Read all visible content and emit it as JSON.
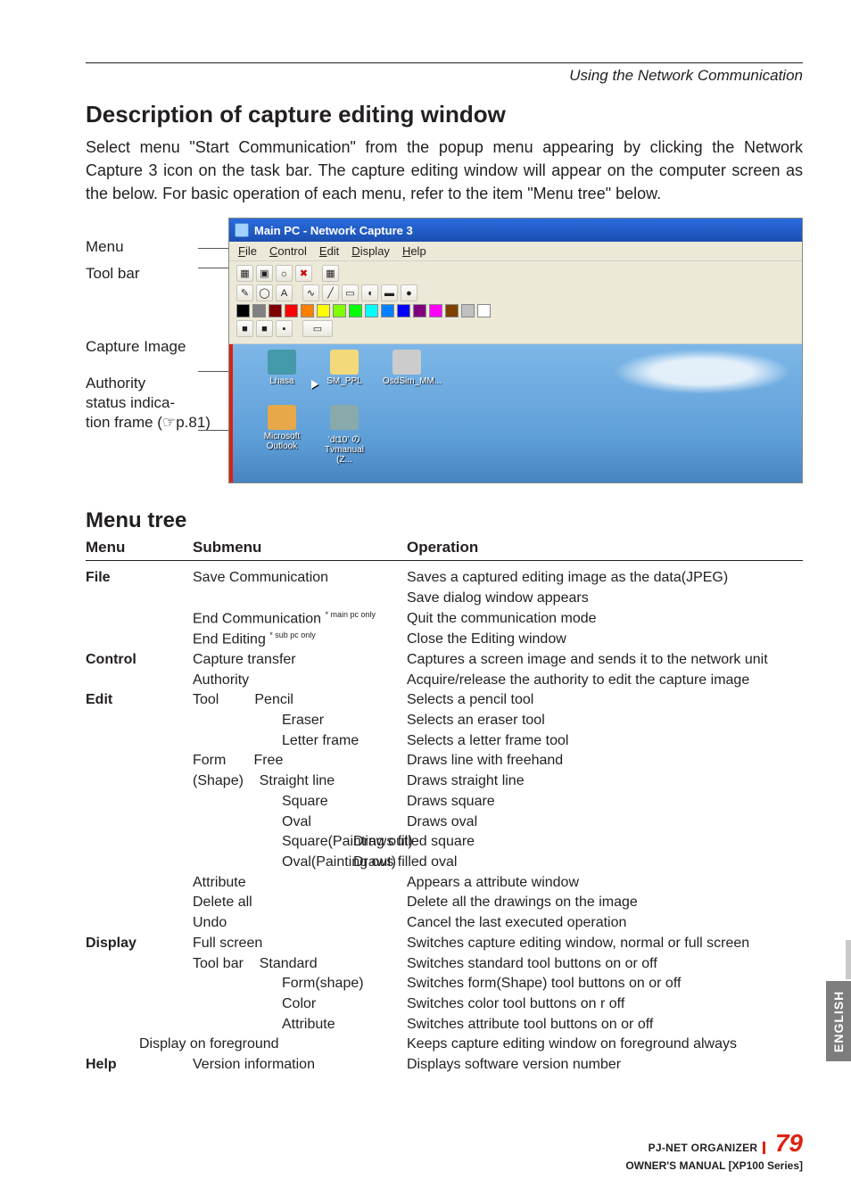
{
  "running_head": "Using the Network Communication",
  "h_desc": "Description of capture editing window",
  "intro": "Select menu \"Start Communication\" from the popup menu appearing by clicking  the Network Capture 3 icon on the task bar. The capture editing window will appear on the computer screen as the below. For basic operation of each menu, refer to the item \"Menu tree\" below.",
  "shot_labels": {
    "menu": "Menu",
    "toolbar": "Tool bar",
    "capture": "Capture Image",
    "auth1": "Authority",
    "auth2": "status indica-",
    "auth3": "tion frame (☞p.81)"
  },
  "shot": {
    "title": "Main PC - Network Capture 3",
    "menus": {
      "file": "File",
      "control": "Control",
      "edit": "Edit",
      "display": "Display",
      "help": "Help"
    },
    "tb_glyphs": {
      "save": "▦",
      "open": "▣",
      "cfg": "☼",
      "close": "✖",
      "grid": "▦",
      "pen": "✎",
      "oval": "◯",
      "A": "A",
      "wave": "∿",
      "line": "╱",
      "rect": "▭",
      "rrect": "◖",
      "frect": "▬",
      "foval": "●"
    },
    "colors": [
      "#000000",
      "#808080",
      "#800000",
      "#ff0000",
      "#ff8000",
      "#ffff00",
      "#80ff00",
      "#00ff00",
      "#00ffff",
      "#0080ff",
      "#0000ff",
      "#800080",
      "#ff00ff",
      "#804000",
      "#c0c0c0",
      "#ffffff"
    ],
    "sizes": [
      "■",
      "■",
      "▪"
    ],
    "desktop_icons": {
      "i1": "Lhasa",
      "i2": "SM_PPL",
      "i3": "OsdSim_MM...",
      "i4": "Microsoft Outlook",
      "i5": "'dt10' の Tvmanual (Z..."
    }
  },
  "h_tree": "Menu tree",
  "cols": {
    "c1": "Menu",
    "c2": "Submenu",
    "c3": "Operation"
  },
  "tree": {
    "file": {
      "label": "File",
      "save_sub": "Save Communication",
      "save_op1": "Saves a captured editing image as the data(JPEG)",
      "save_op2": "Save dialog window appears",
      "endc_sub": "End Communication ",
      "endc_sup": "* main pc only",
      "endc_op": "Quit the communication mode",
      "ende_sub": "End Editing ",
      "ende_sup": "* sub pc only",
      "ende_op": "Close the Editing window"
    },
    "control": {
      "label": "Control",
      "cap_sub": "Capture transfer",
      "cap_op": "Captures a screen image and sends it to the network unit",
      "auth_sub": "Authority",
      "auth_op": "Acquire/release the authority to edit the capture image"
    },
    "edit": {
      "label": "Edit",
      "tool": "Tool",
      "pencil": "Pencil",
      "pencil_op": "Selects a pencil tool",
      "eraser": "Eraser",
      "eraser_op": "Selects an eraser tool",
      "letter": "Letter frame",
      "letter_op": "Selects a letter frame tool",
      "form": "Form",
      "shape": "(Shape)",
      "free": "Free",
      "free_op": "Draws line with freehand",
      "stline": "Straight line",
      "stline_op": "Draws straight line",
      "square": "Square",
      "square_op": "Draws square",
      "oval": "Oval",
      "oval_op": "Draws oval",
      "sqpo": "Square(Painting out)",
      "sqpo_op": "Draws filled square",
      "ovpo": "Oval(Painting out)",
      "ovpo_op": "Draws filled oval",
      "attr": "Attribute",
      "attr_op": "Appears a attribute window",
      "del": "Delete all",
      "del_op": "Delete all the drawings on the image",
      "undo": "Undo",
      "undo_op": "Cancel the last executed operation"
    },
    "display": {
      "label": "Display",
      "full": "Full screen",
      "full_op": "Switches capture editing window, normal or full screen",
      "tb": "Tool bar",
      "std": "Standard",
      "std_op": "Switches standard tool buttons on or off",
      "fs": "Form(shape)",
      "fs_op": "Switches form(Shape) tool buttons on or off",
      "col": "Color",
      "col_op": "Switches color tool buttons on r off",
      "at": "Attribute",
      "at_op": "Switches attribute tool buttons on or off",
      "fg": "Display on foreground",
      "fg_op": "Keeps capture editing window on foreground always"
    },
    "help": {
      "label": "Help",
      "ver": "Version information",
      "ver_op": "Displays software version number"
    }
  },
  "side_tab": "ENGLISH",
  "footer": {
    "product": "PJ-NET ORGANIZER",
    "page": "79",
    "owner": "OWNER'S MANUAL [XP100 Series]"
  }
}
